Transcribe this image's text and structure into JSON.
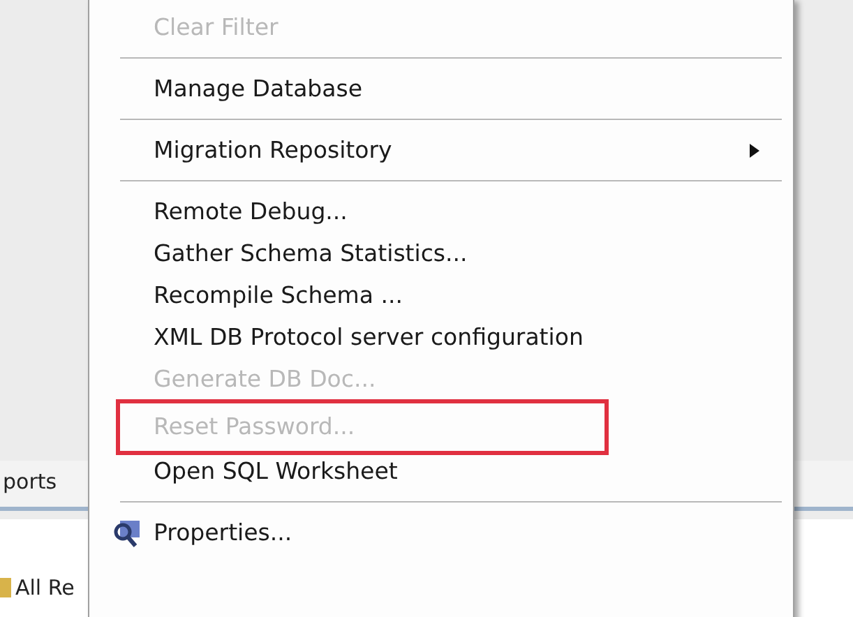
{
  "background": {
    "tab_label": "ports",
    "list_item": "All Re"
  },
  "menu": {
    "items": [
      {
        "kind": "item",
        "label": "Clear Filter",
        "disabled": true,
        "highlighted": false
      },
      {
        "kind": "separator"
      },
      {
        "kind": "item",
        "label": "Manage Database",
        "disabled": false,
        "highlighted": false
      },
      {
        "kind": "separator"
      },
      {
        "kind": "submenu",
        "label": "Migration Repository",
        "disabled": false,
        "highlighted": false
      },
      {
        "kind": "separator"
      },
      {
        "kind": "item",
        "label": "Remote Debug...",
        "disabled": false,
        "highlighted": false
      },
      {
        "kind": "item",
        "label": "Gather Schema Statistics...",
        "disabled": false,
        "highlighted": false
      },
      {
        "kind": "item",
        "label": "Recompile Schema ...",
        "disabled": false,
        "highlighted": false
      },
      {
        "kind": "item",
        "label": "XML DB Protocol server configuration",
        "disabled": false,
        "highlighted": false
      },
      {
        "kind": "item",
        "label": "Generate DB Doc...",
        "disabled": true,
        "highlighted": false
      },
      {
        "kind": "item",
        "label": "Reset Password...",
        "disabled": true,
        "highlighted": true
      },
      {
        "kind": "item",
        "label": "Open SQL Worksheet",
        "disabled": false,
        "highlighted": false
      },
      {
        "kind": "separator"
      },
      {
        "kind": "icon_item",
        "label": "Properties...",
        "disabled": false,
        "highlighted": false
      }
    ]
  }
}
